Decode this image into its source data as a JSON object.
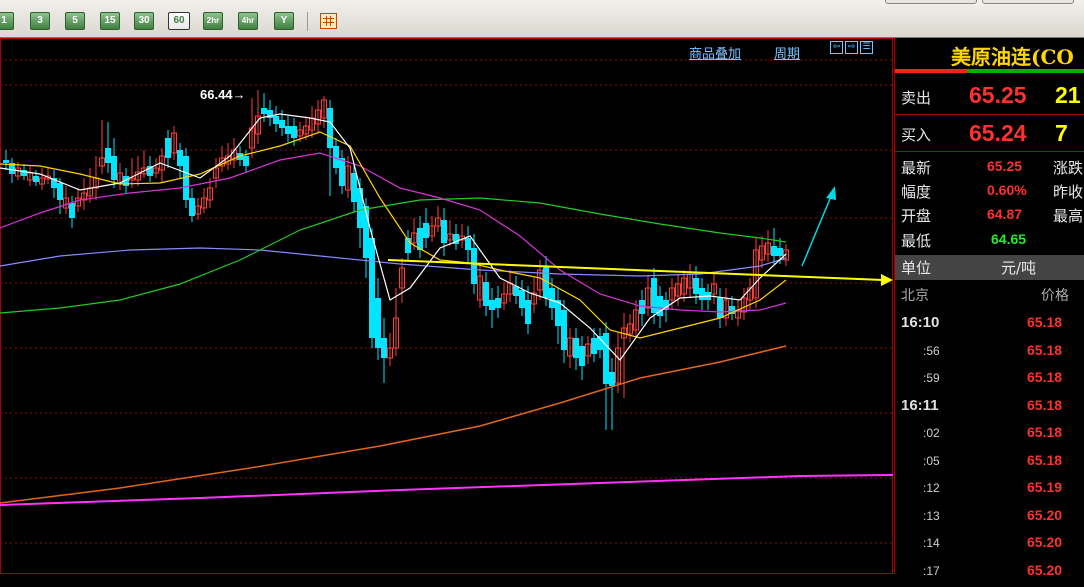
{
  "toolbar": {
    "period_buttons": [
      "1",
      "3",
      "5",
      "15",
      "30",
      "60",
      "2hr",
      "4hr",
      "Y"
    ],
    "active_period": "60"
  },
  "chart": {
    "links": {
      "overlay": "商品叠加",
      "period": "周期"
    },
    "high_annotation": "66.44→",
    "colors": {
      "up": "#ff3b3b",
      "down": "#00e5ff",
      "ma5": "#ffffff",
      "ma10": "#ffd400",
      "ma20": "#d633d6",
      "ma60": "#22cc22",
      "ma120": "#8a8aff",
      "ma250": "#e0661a",
      "ma_long": "#ff33ff",
      "arrow_yellow": "#ffff00",
      "arrow_cyan": "#00d8e8"
    }
  },
  "quote": {
    "title": "美原油连(CO",
    "sell": {
      "label": "卖出",
      "price": "65.25",
      "volume": "21"
    },
    "buy": {
      "label": "买入",
      "price": "65.24",
      "volume": "7"
    },
    "rows": [
      {
        "label": "最新",
        "value": "65.25",
        "color": "#ff3030",
        "label2": "涨跌"
      },
      {
        "label": "幅度",
        "value": "0.60%",
        "color": "#ff3030",
        "label2": "昨收"
      },
      {
        "label": "开盘",
        "value": "64.87",
        "color": "#ff3030",
        "label2": "最高"
      },
      {
        "label": "最低",
        "value": "64.65",
        "color": "#22ee22",
        "label2": ""
      }
    ],
    "unit_label": "单位",
    "unit_value": "元/吨",
    "ticks_header": {
      "time": "北京",
      "price": "价格"
    },
    "ticks": [
      {
        "time": "16:10",
        "price": "65.18",
        "full": true
      },
      {
        "time": ":56",
        "price": "65.18",
        "full": false
      },
      {
        "time": ":59",
        "price": "65.18",
        "full": false
      },
      {
        "time": "16:11",
        "price": "65.18",
        "full": true
      },
      {
        "time": ":02",
        "price": "65.18",
        "full": false
      },
      {
        "time": ":05",
        "price": "65.18",
        "full": false
      },
      {
        "time": ":12",
        "price": "65.19",
        "full": false
      },
      {
        "time": ":13",
        "price": "65.20",
        "full": false
      },
      {
        "time": ":14",
        "price": "65.20",
        "full": false
      },
      {
        "time": ":17",
        "price": "65.20",
        "full": false
      }
    ]
  }
}
